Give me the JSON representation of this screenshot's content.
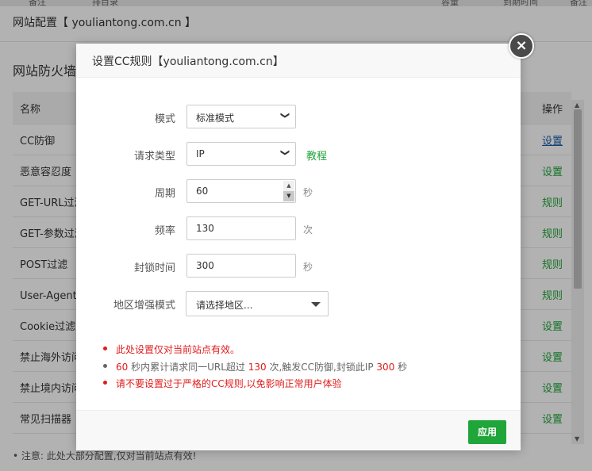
{
  "background": {
    "top_strip": [
      "备注",
      "排目录",
      "容量",
      "到期时间",
      "备注"
    ],
    "window_title": "网站配置【 youliantong.com.cn 】",
    "heading": "网站防火墙",
    "table": {
      "header": {
        "name": "名称",
        "action": "操作"
      },
      "rows": [
        {
          "name": "CC防御",
          "action": "设置"
        },
        {
          "name": "恶意容忍度",
          "action": "设置"
        },
        {
          "name": "GET-URL过滤",
          "action": "规则"
        },
        {
          "name": "GET-参数过滤",
          "action": "规则"
        },
        {
          "name": "POST过滤",
          "action": "规则"
        },
        {
          "name": "User-Agent过滤",
          "action": "规则"
        },
        {
          "name": "Cookie过滤",
          "action": "设置"
        },
        {
          "name": "禁止海外访问",
          "action": "设置"
        },
        {
          "name": "禁止境内访问",
          "action": "设置"
        },
        {
          "name": "常见扫描器",
          "action": "设置"
        }
      ]
    },
    "note": "注意: 此处大部分配置,仅对当前站点有效!"
  },
  "dialog": {
    "title": "设置CC规则【youliantong.com.cn】",
    "close_symbol": "×",
    "mode": {
      "label": "模式",
      "value": "标准模式"
    },
    "request_type": {
      "label": "请求类型",
      "value": "IP",
      "tutorial": "教程"
    },
    "period": {
      "label": "周期",
      "value": "60",
      "unit": "秒"
    },
    "frequency": {
      "label": "频率",
      "value": "130",
      "unit": "次"
    },
    "block_time": {
      "label": "封锁时间",
      "value": "300",
      "unit": "秒"
    },
    "region": {
      "label": "地区增强模式",
      "placeholder": "请选择地区..."
    },
    "tips": {
      "tip1": "此处设置仅对当前站点有效。",
      "tip2": {
        "v1": "60",
        "t1": " 秒内累计请求同一URL超过 ",
        "v2": "130",
        "t2": " 次,触发CC防御,封锁此IP ",
        "v3": "300",
        "t3": " 秒"
      },
      "tip3": "请不要设置过于严格的CC规则,以免影响正常用户体验"
    },
    "apply_label": "应用"
  },
  "colors": {
    "accent_green": "#20a53a",
    "warning_red": "#e01c1c",
    "link_blue": "#1e5da8"
  }
}
